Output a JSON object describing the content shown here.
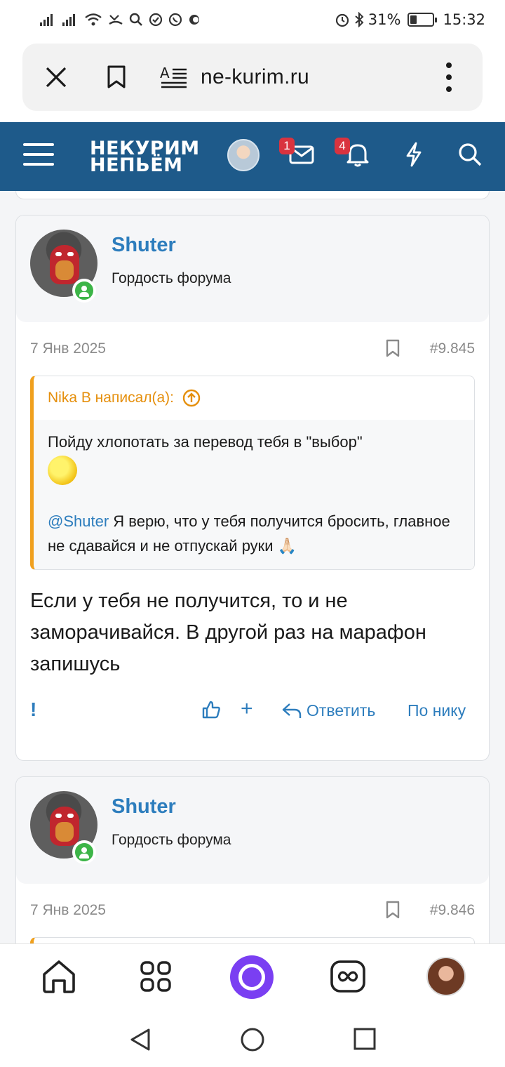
{
  "status_bar": {
    "battery": "31%",
    "battery_level": 0.31,
    "time": "15:32"
  },
  "browser": {
    "url": "ne-kurim.ru"
  },
  "site_header": {
    "logo_line1": "НЕКУРИМ",
    "logo_line2": "НЕПЬЁМ",
    "messages_badge": "1",
    "alerts_badge": "4"
  },
  "posts": [
    {
      "username": "Shuter",
      "user_title": "Гордость форума",
      "date": "7 Янв 2025",
      "number": "#9.845",
      "quote": {
        "author": "Nika B написал(а):",
        "line1": "Пойду хлопотать за перевод тебя в \"выбор\"",
        "mention": "@Shuter",
        "line2": " Я верю, что у тебя получится бросить, главное не сдавайся и не отпускай руки 🙏🏻"
      },
      "text": "Если у тебя не получится, то и не заморачивайся. В другой раз на марафон запишусь",
      "actions": {
        "exclaim": "!",
        "plus": "+",
        "reply": "Ответить",
        "by_nick": "По нику"
      }
    },
    {
      "username": "Shuter",
      "user_title": "Гордость форума",
      "date": "7 Янв 2025",
      "number": "#9.846"
    }
  ]
}
